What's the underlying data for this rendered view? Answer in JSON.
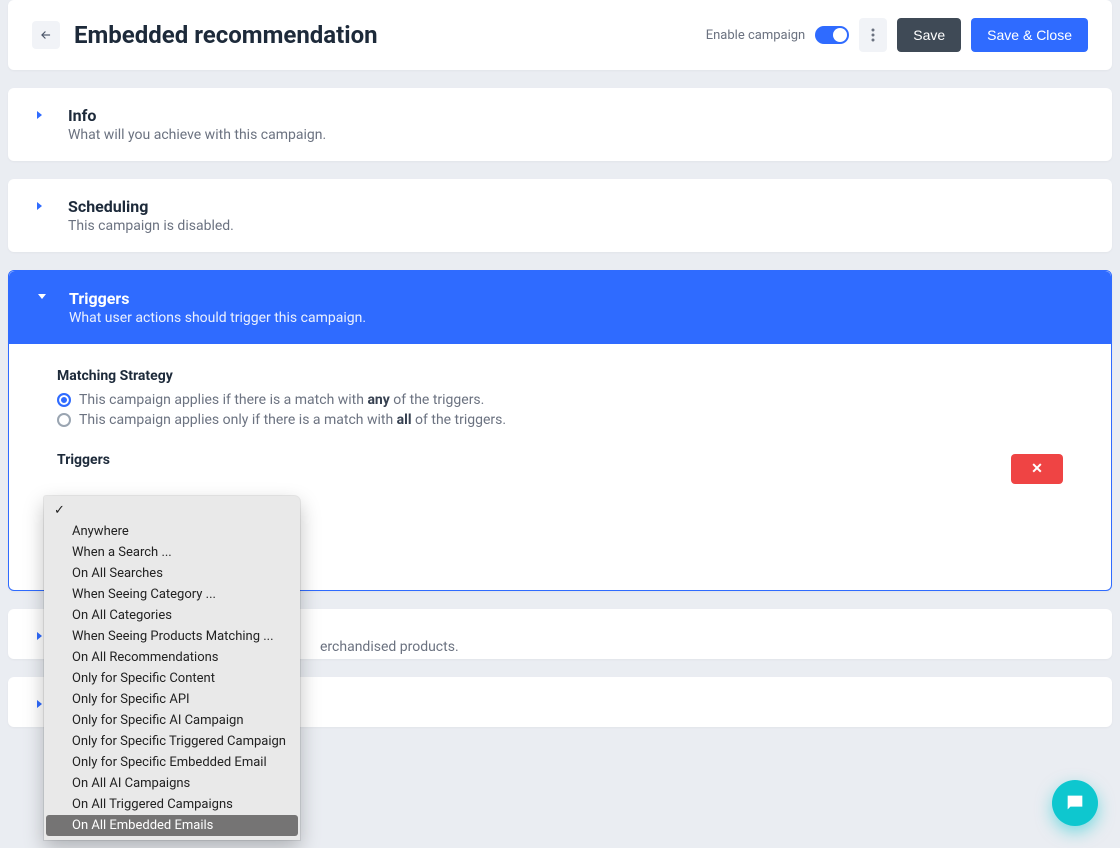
{
  "header": {
    "title": "Embedded recommendation",
    "enable_label": "Enable campaign",
    "save_label": "Save",
    "save_close_label": "Save & Close"
  },
  "sections": {
    "info": {
      "title": "Info",
      "subtitle": "What will you achieve with this campaign."
    },
    "scheduling": {
      "title": "Scheduling",
      "subtitle": "This campaign is disabled."
    },
    "triggers": {
      "title": "Triggers",
      "subtitle": "What user actions should trigger this campaign."
    },
    "lower": {
      "subtitle_fragment": "erchandised products."
    }
  },
  "triggers_body": {
    "matching_heading": "Matching Strategy",
    "radio_any_pre": "This campaign applies if there is a match with ",
    "radio_any_bold": "any",
    "radio_any_post": " of the triggers.",
    "radio_all_pre": "This campaign applies only if there is a match with ",
    "radio_all_bold": "all",
    "radio_all_post": " of the triggers.",
    "triggers_label": "Triggers",
    "delete_icon": "✕"
  },
  "dropdown": {
    "checkmark": "✓",
    "items": [
      "Anywhere",
      "When a Search ...",
      "On All Searches",
      "When Seeing Category ...",
      "On All Categories",
      "When Seeing Products Matching ...",
      "On All Recommendations",
      "Only for Specific Content",
      "Only for Specific API",
      "Only for Specific AI Campaign",
      "Only for Specific Triggered Campaign",
      "Only for Specific Embedded Email",
      "On All AI Campaigns",
      "On All Triggered Campaigns",
      "On All Embedded Emails"
    ],
    "highlighted_index": 14
  },
  "chat": {
    "aria": "Open chat"
  }
}
